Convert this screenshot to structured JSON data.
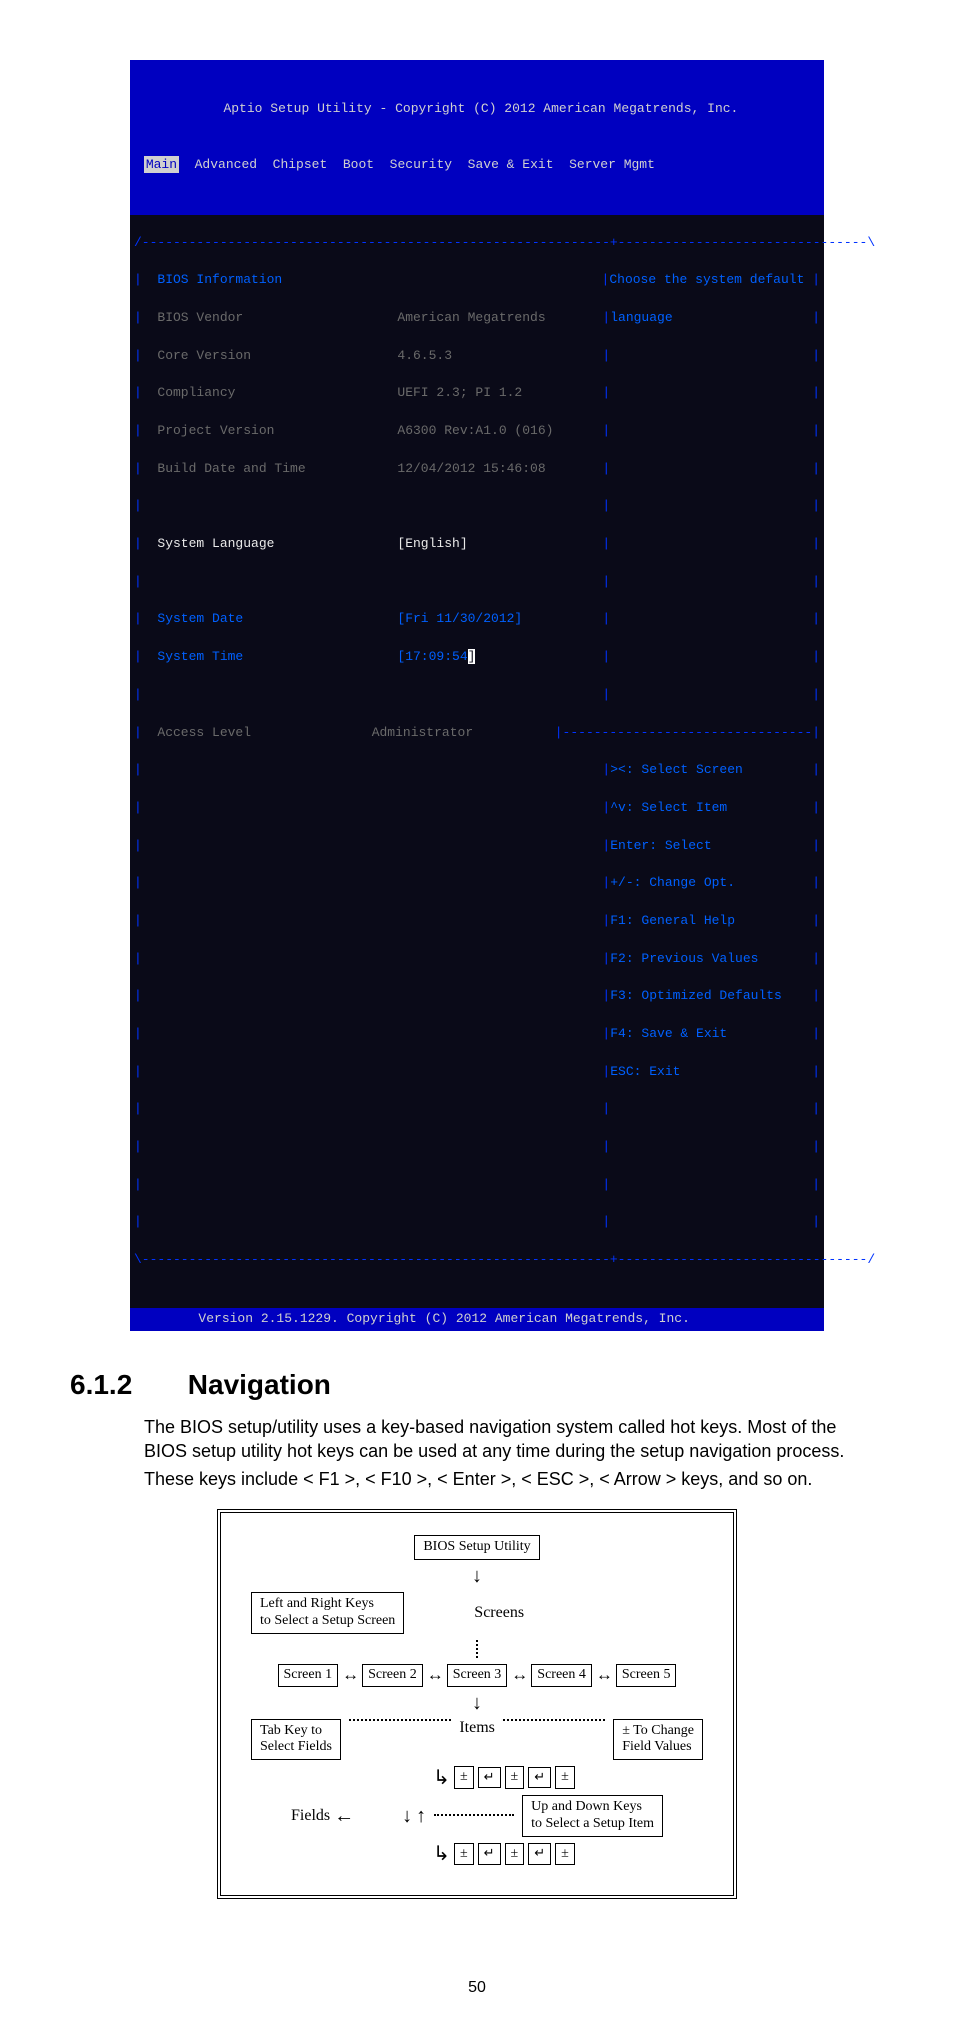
{
  "bios": {
    "title": " Aptio Setup Utility - Copyright (C) 2012 American Megatrends, Inc.",
    "menu": {
      "active": "Main",
      "rest": "  Advanced  Chipset  Boot  Security  Save & Exit  Server Mgmt"
    },
    "help": {
      "line1": "Choose the system default",
      "line2": "language"
    },
    "section_heading": "BIOS Information",
    "rows": {
      "vendor_label": "BIOS Vendor",
      "vendor_value": "American Megatrends",
      "core_label": "Core Version",
      "core_value": "4.6.5.3",
      "comp_label": "Compliancy",
      "comp_value": "UEFI 2.3; PI 1.2",
      "proj_label": "Project Version",
      "proj_value": "A6300 Rev:A1.0 (016)",
      "build_label": "Build Date and Time",
      "build_value": "12/04/2012 15:46:08",
      "lang_label": "System Language",
      "lang_value": "[English]",
      "date_label": "System Date",
      "date_value": "[Fri 11/30/2012]",
      "time_label": "System Time",
      "time_value_a": "[17:09:54",
      "time_value_b": "]",
      "access_label": "Access Level",
      "access_value": "Administrator"
    },
    "keyhelp": {
      "k1": "><: Select Screen",
      "k2": "^v: Select Item",
      "k3": "Enter: Select",
      "k4": "+/-: Change Opt.",
      "k5": "F1: General Help",
      "k6": "F2: Previous Values",
      "k7": "F3: Optimized Defaults",
      "k8": "F4: Save & Exit",
      "k9": "ESC: Exit"
    },
    "footer": "        Version 2.15.1229. Copyright (C) 2012 American Megatrends, Inc."
  },
  "section": {
    "number": "6.1.2",
    "title": "Navigation"
  },
  "para": {
    "p1": "The BIOS setup/utility uses a key-based navigation system called hot keys. Most of the BIOS setup utility hot keys can be used at any time during the setup navigation process.",
    "p2": "These keys include < F1 >, < F10 >, < Enter >, < ESC >, < Arrow > keys, and so on."
  },
  "diagram": {
    "top": "BIOS Setup Utility",
    "leftkeys": "Left and Right Keys\nto Select a Setup Screen",
    "screens_label": "Screens",
    "screens": [
      "Screen 1",
      "Screen 2",
      "Screen 3",
      "Screen 4",
      "Screen 5"
    ],
    "tabkey": "Tab Key to\nSelect Fields",
    "items_label": "Items",
    "change": "± To Change\nField Values",
    "fields_label": "Fields",
    "updown": "Up and Down Keys\nto Select a Setup Item",
    "pm": "±"
  },
  "pagenum": "50"
}
